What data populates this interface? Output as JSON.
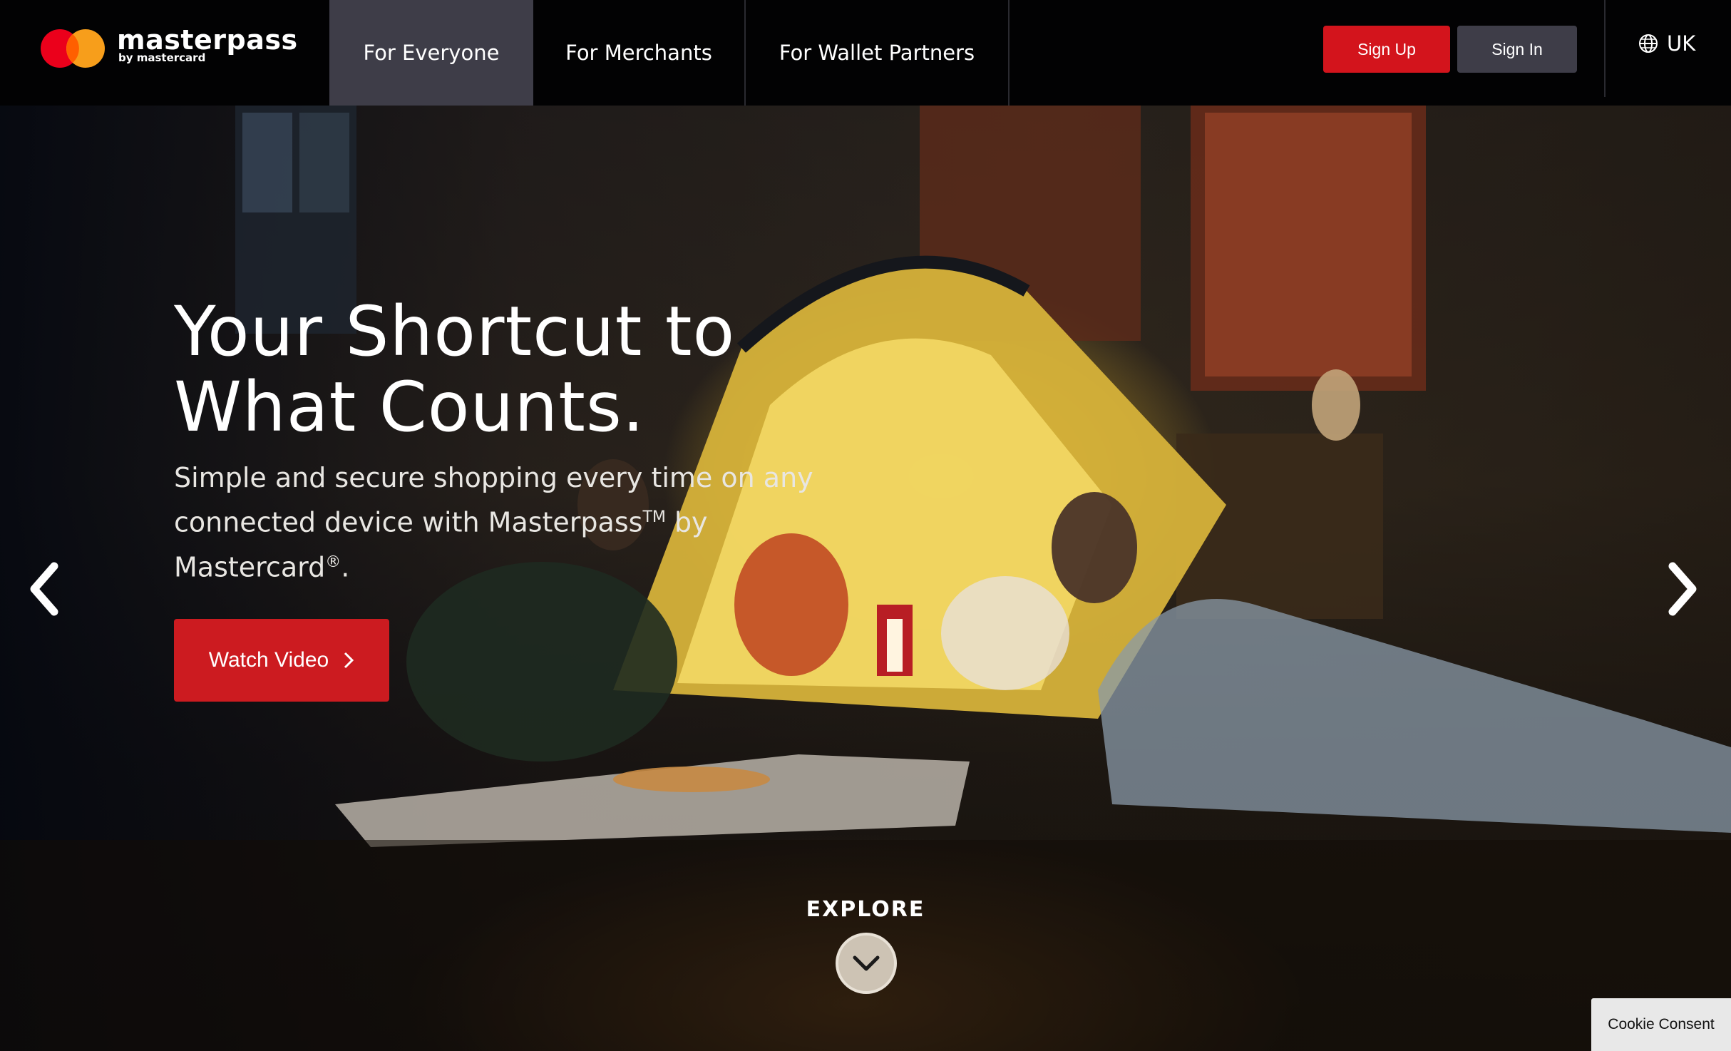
{
  "brand": {
    "name": "masterpass",
    "sub": "by mastercard",
    "colors": {
      "red": "#eb001b",
      "orange": "#f79e1b",
      "overlap": "#ff5f00"
    }
  },
  "nav": {
    "items": [
      {
        "label": "For Everyone",
        "active": true
      },
      {
        "label": "For Merchants",
        "active": false
      },
      {
        "label": "For Wallet Partners",
        "active": false
      }
    ]
  },
  "header": {
    "signup_label": "Sign Up",
    "signin_label": "Sign In",
    "locale": "UK",
    "locale_icon": "globe-icon",
    "signup_color": "#d3141c",
    "signin_color": "#3e3d48"
  },
  "hero": {
    "title_line1": "Your Shortcut to",
    "title_line2": "What Counts.",
    "sub_part1": "Simple and secure shopping every time on any connected device with Masterpass",
    "sub_tm": "TM",
    "sub_part2": " by Mastercard",
    "sub_reg": "®",
    "sub_part3": ".",
    "cta_label": "Watch Video",
    "cta_color": "#cc1b20",
    "prev_icon": "chevron-left-icon",
    "next_icon": "chevron-right-icon"
  },
  "explore": {
    "label": "EXPLORE",
    "icon": "chevron-down-icon"
  },
  "cookie": {
    "label": "Cookie Consent"
  }
}
